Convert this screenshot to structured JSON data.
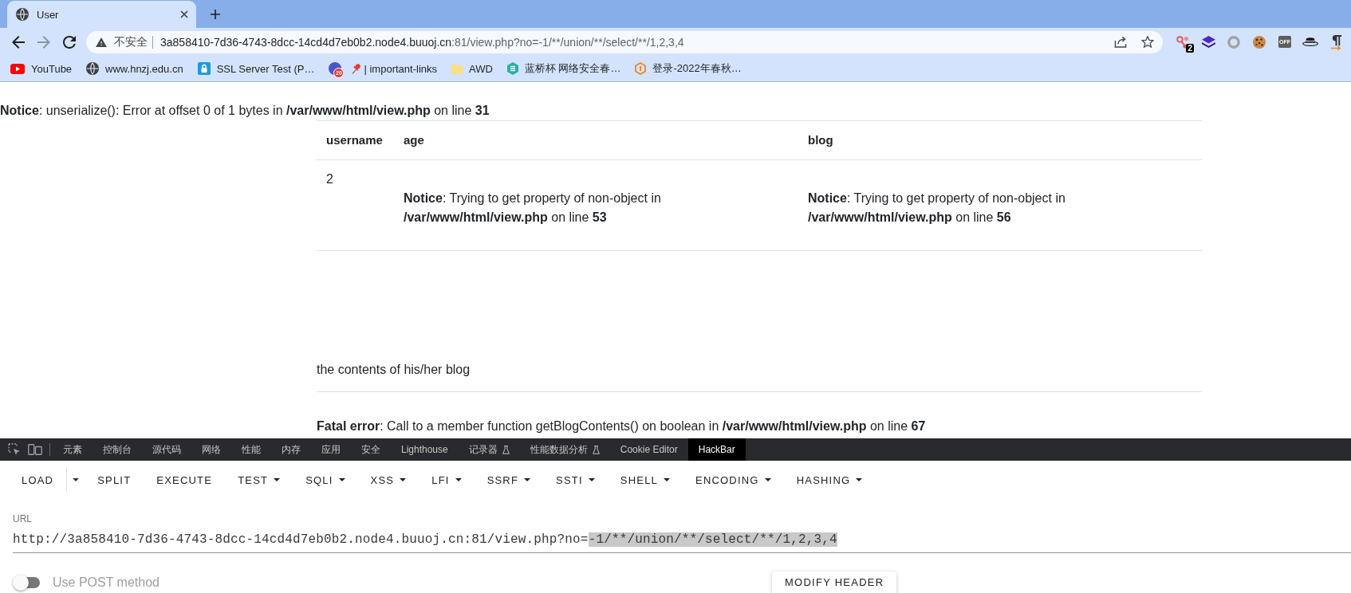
{
  "browser": {
    "tab": {
      "title": "User"
    },
    "nav_buttons": [
      {
        "kind": "back",
        "disabled": false
      },
      {
        "kind": "forward",
        "disabled": true
      },
      {
        "kind": "reload",
        "disabled": false
      }
    ],
    "address_bar": {
      "security_label": "不安全",
      "url_host": "3a858410-7d36-4743-8dcc-14cd4d7eb0b2.node4.buuoj.cn",
      "url_rest": ":81/view.php?no=-1/**/union/**/select/**/1,2,3,4"
    },
    "extensions": [
      {
        "kind": "nodes",
        "badge": "2"
      },
      {
        "kind": "layers"
      },
      {
        "kind": "ring"
      },
      {
        "kind": "cookie"
      },
      {
        "kind": "label",
        "label": "OFF"
      },
      {
        "kind": "hat"
      },
      {
        "kind": "pilcrow"
      }
    ],
    "bookmarks": [
      {
        "kind": "video",
        "label": "YouTube"
      },
      {
        "kind": "globe",
        "label": "www.hnzj.edu.cn"
      },
      {
        "kind": "lock",
        "label": "SSL Server Test (P…"
      },
      {
        "kind": "pinned",
        "badge": "20",
        "label": "| important-links"
      },
      {
        "kind": "folder",
        "label": "AWD"
      },
      {
        "kind": "layers",
        "label": "蓝桥杯 网络安全春…"
      },
      {
        "kind": "hexagon",
        "label": "登录-2022年春秋…"
      }
    ]
  },
  "page": {
    "notice": "**Notice**: unserialize(): Error at offset 0 of 1 bytes in **/var/www/html/view.php** on line **31**",
    "table": {
      "columns": [
        "username",
        "age",
        "blog"
      ],
      "rows": [
        {
          "cells": [
            {
              "kind": "text",
              "text": "2"
            },
            {
              "kind": "notice",
              "text": "**Notice**: Trying to get property of non-object in **/var/www/html/view.php** on line **53**"
            },
            {
              "kind": "notice",
              "text": "**Notice**: Trying to get property of non-object in **/var/www/html/view.php** on line **56**"
            }
          ]
        }
      ]
    },
    "blog_text": "the contents of his/her blog",
    "fatal_error": "**Fatal error**: Call to a member function getBlogContents() on boolean in **/var/www/html/view.php** on line **67**"
  },
  "devtools": {
    "tools": [
      {
        "kind": "inspect"
      },
      {
        "kind": "device"
      }
    ],
    "tabs": [
      {
        "label": "元素",
        "selected": false,
        "experimental": false
      },
      {
        "label": "控制台",
        "selected": false,
        "experimental": false
      },
      {
        "label": "源代码",
        "selected": false,
        "experimental": false
      },
      {
        "label": "网络",
        "selected": false,
        "experimental": false
      },
      {
        "label": "性能",
        "selected": false,
        "experimental": false
      },
      {
        "label": "内存",
        "selected": false,
        "experimental": false
      },
      {
        "label": "应用",
        "selected": false,
        "experimental": false
      },
      {
        "label": "安全",
        "selected": false,
        "experimental": false
      },
      {
        "label": "Lighthouse",
        "selected": false,
        "experimental": false
      },
      {
        "label": "记录器",
        "selected": false,
        "experimental": true
      },
      {
        "label": "性能数据分析",
        "selected": false,
        "experimental": true
      },
      {
        "label": "Cookie Editor",
        "selected": false,
        "experimental": false
      },
      {
        "label": "HackBar",
        "selected": true,
        "experimental": false
      }
    ]
  },
  "hackbar": {
    "buttons": [
      {
        "label": "LOAD",
        "kind": "split"
      },
      {
        "label": "SPLIT",
        "kind": "plain"
      },
      {
        "label": "EXECUTE",
        "kind": "plain"
      },
      {
        "label": "TEST",
        "kind": "menu"
      },
      {
        "label": "SQLI",
        "kind": "menu"
      },
      {
        "label": "XSS",
        "kind": "menu"
      },
      {
        "label": "LFI",
        "kind": "menu"
      },
      {
        "label": "SSRF",
        "kind": "menu"
      },
      {
        "label": "SSTI",
        "kind": "menu"
      },
      {
        "label": "SHELL",
        "kind": "menu"
      },
      {
        "label": "ENCODING",
        "kind": "menu"
      },
      {
        "label": "HASHING",
        "kind": "menu"
      }
    ],
    "url_field": {
      "label": "URL",
      "value_parts": [
        {
          "text": "http://3a858410-7d36-4743-8dcc-14cd4d7eb0b2.node4.buuoj.cn:81/view.php?no=",
          "selected": false
        },
        {
          "text": "-1/**/union/**/select/**/1,2,3,4",
          "selected": true
        }
      ]
    },
    "post_toggle": {
      "label": "Use POST method",
      "on": false
    },
    "modify_header": {
      "label": "MODIFY HEADER"
    }
  }
}
